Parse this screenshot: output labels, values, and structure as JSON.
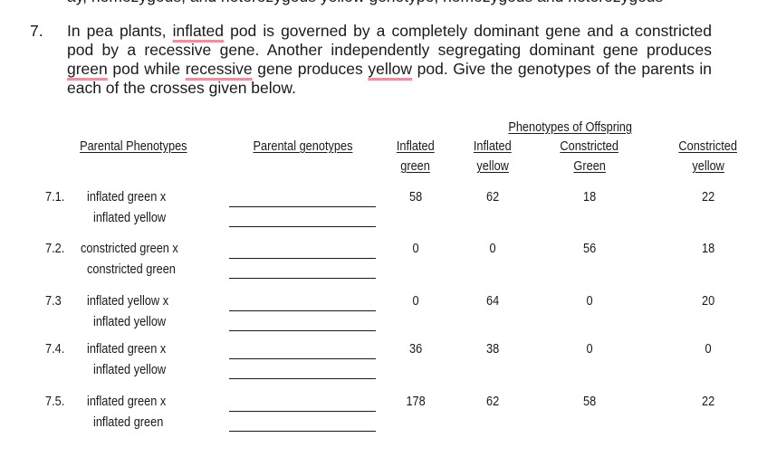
{
  "question": {
    "number": "7.",
    "segments": [
      {
        "t": "In pea plants, "
      },
      {
        "t": "inflated",
        "spell": true
      },
      {
        "t": " pod is governed by a completely dominant gene and a constricted pod by a recessive gene. Another independently segregating dominant gene produces "
      },
      {
        "t": "green",
        "spell": true
      },
      {
        "t": " pod while "
      },
      {
        "t": "recessive",
        "spell": true
      },
      {
        "t": " gene produces "
      },
      {
        "t": "yellow",
        "spell": true
      },
      {
        "t": " pod. Give the genotypes of the parents in each of the crosses given below."
      }
    ]
  },
  "table": {
    "group_header": "Phenotypes of Offspring",
    "headers": {
      "parental_phenotypes": "Parental Phenotypes",
      "parental_genotypes": "Parental genotypes",
      "offspring": [
        [
          "Inflated",
          "green"
        ],
        [
          "Inflated",
          "yellow"
        ],
        [
          "Constricted",
          "Green"
        ],
        [
          "Constricted",
          "yellow"
        ]
      ]
    },
    "rows": [
      {
        "id": "7.1.",
        "parent1": "inflated green x",
        "parent2": "inflated yellow",
        "genotype1": "",
        "genotype2": "",
        "counts": [
          "58",
          "62",
          "18",
          "22"
        ]
      },
      {
        "id": "7.2.",
        "parent1": "constricted green x",
        "parent2": "constricted green",
        "genotype1": "",
        "genotype2": "",
        "counts": [
          "0",
          "0",
          "56",
          "18"
        ]
      },
      {
        "id": "7.3",
        "parent1": "inflated yellow x",
        "parent2": "inflated yellow",
        "genotype1": "",
        "genotype2": "",
        "counts": [
          "0",
          "64",
          "0",
          "20"
        ]
      },
      {
        "id": "7.4.",
        "parent1": "inflated green x",
        "parent2": "inflated yellow",
        "genotype1": "",
        "genotype2": "",
        "counts": [
          "36",
          "38",
          "0",
          "0"
        ]
      },
      {
        "id": "7.5.",
        "parent1": "inflated green x",
        "parent2": "inflated green",
        "genotype1": "",
        "genotype2": "",
        "counts": [
          "178",
          "62",
          "58",
          "22"
        ]
      }
    ]
  }
}
